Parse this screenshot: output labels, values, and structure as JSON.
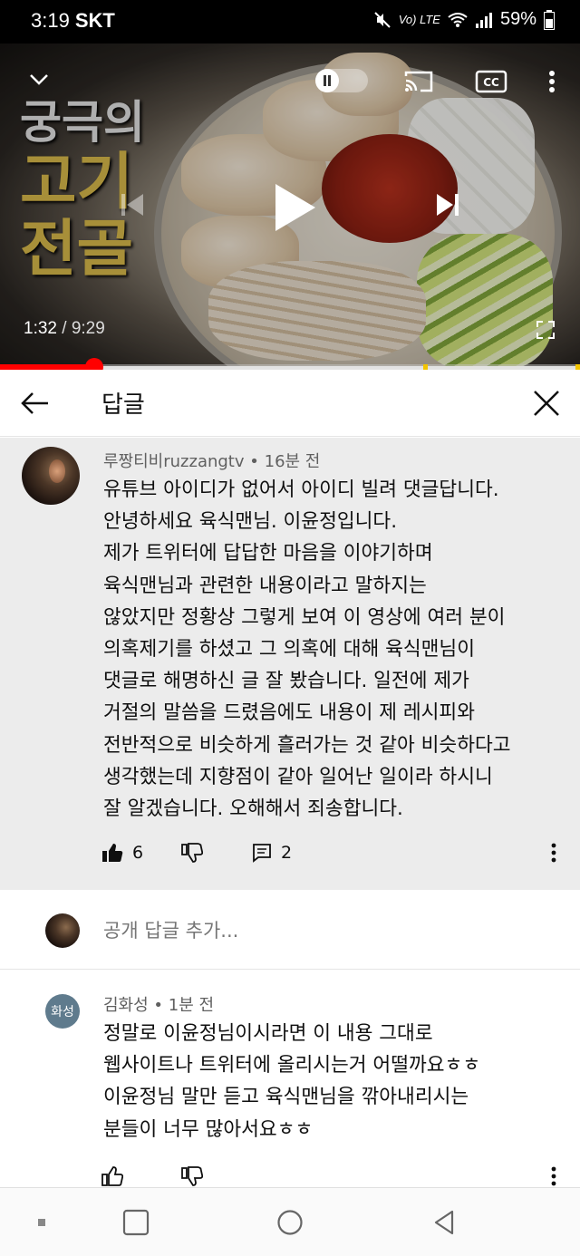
{
  "status_bar": {
    "time": "3:19",
    "carrier": "SKT",
    "network": "Vo) LTE",
    "battery": "59%"
  },
  "video": {
    "title_overlay": [
      "궁극의",
      "고기",
      "전골"
    ],
    "current_time": "1:32",
    "separator": "/",
    "duration": "9:29",
    "progress_fraction": 0.162,
    "ad_marker_fractions": [
      0.73,
      0.993
    ],
    "controls": {
      "minimize_icon": "chevron-down-icon",
      "autoplay_icon": "pause-toggle-icon",
      "cast_icon": "cast-icon",
      "cc_icon": "closed-captions-icon",
      "more_icon": "more-vertical-icon",
      "prev_icon": "skip-previous-icon",
      "play_icon": "play-icon",
      "next_icon": "skip-next-icon",
      "fullscreen_icon": "fullscreen-icon"
    }
  },
  "replies_header": {
    "title": "답글",
    "back_icon": "arrow-left-icon",
    "close_icon": "close-icon"
  },
  "main_comment": {
    "author": "루짱티비ruzzangtv",
    "separator": "•",
    "time": "16분 전",
    "lines": [
      "유튜브 아이디가 없어서 아이디 빌려 댓글답니다.",
      "안녕하세요 육식맨님. 이윤정입니다.",
      "제가 트위터에 답답한 마음을 이야기하며",
      "육식맨님과 관련한 내용이라고 말하지는",
      "않았지만 정황상 그렇게 보여 이 영상에 여러 분이",
      "의혹제기를 하셨고 그 의혹에 대해 육식맨님이",
      "댓글로 해명하신 글 잘 봤습니다. 일전에 제가",
      "거절의 말씀을 드렸음에도 내용이 제 레시피와",
      "전반적으로 비슷하게 흘러가는 것 같아 비슷하다고",
      "생각했는데 지향점이 같아 일어난 일이라 하시니",
      "잘 알겠습니다. 오해해서 죄송합니다."
    ],
    "likes": "6",
    "replies": "2"
  },
  "add_reply": {
    "placeholder": "공개 답글 추가..."
  },
  "reply": {
    "avatar_text": "화성",
    "author": "김화성",
    "separator": "•",
    "time": "1분 전",
    "lines": [
      "정말로 이윤정님이시라면 이 내용 그대로",
      "웹사이트나 트위터에 올리시는거 어떨까요ㅎㅎ",
      "이윤정님 말만 듣고 육식맨님을 깎아내리시는",
      "분들이 너무 많아서요ㅎㅎ"
    ]
  },
  "colors": {
    "accent": "#ff0000",
    "comment_bg": "#ececec",
    "reply_avatar": "#5f7b8d"
  }
}
